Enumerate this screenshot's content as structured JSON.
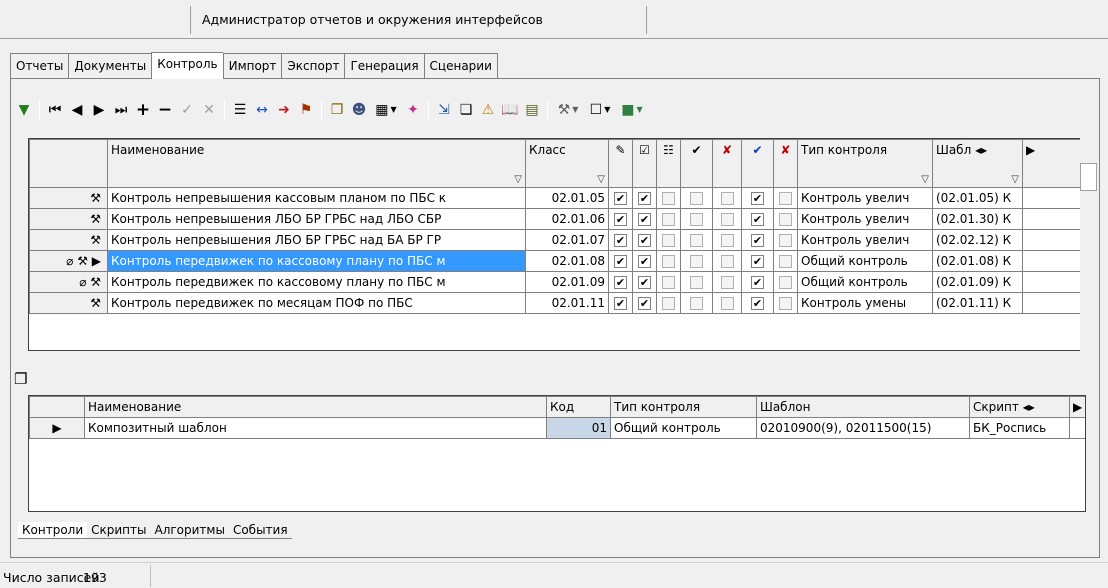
{
  "window": {
    "title": "Администратор отчетов и окружения интерфейсов"
  },
  "main_tabs": [
    {
      "label": "Отчеты",
      "active": false
    },
    {
      "label": "Документы",
      "active": false
    },
    {
      "label": "Контроль",
      "active": true
    },
    {
      "label": "Импорт",
      "active": false
    },
    {
      "label": "Экспорт",
      "active": false
    },
    {
      "label": "Генерация",
      "active": false
    },
    {
      "label": "Сценарии",
      "active": false
    }
  ],
  "toolbar": {
    "icons": [
      "filter-icon",
      "first-record-icon",
      "prev-record-icon",
      "next-record-icon",
      "last-record-icon",
      "add-record-icon",
      "delete-record-icon",
      "edit-record-icon",
      "cancel-record-icon",
      "list-icon",
      "link-icon",
      "export-icon",
      "flag-icon",
      "copy-icon",
      "users-icon",
      "table-icon",
      "puzzle-icon",
      "import-icon",
      "duplicate-icon",
      "warning-icon",
      "book-icon",
      "checklist-icon",
      "hammer-icon",
      "properties-icon",
      "cube-icon"
    ]
  },
  "grid1": {
    "columns": [
      "Наименование",
      "Класс",
      "Тип контроля",
      "Шабл"
    ],
    "rows": [
      {
        "name": "Контроль непревышения кассовым планом по ПБС к",
        "class": "02.01.05",
        "checks": [
          true,
          true,
          false,
          false,
          false,
          true,
          false
        ],
        "type": "Контроль увелич",
        "template": "(02.01.05) К"
      },
      {
        "name": "Контроль непревышения ЛБО БР ГРБС над ЛБО СБР",
        "class": "02.01.06",
        "checks": [
          true,
          true,
          false,
          false,
          false,
          true,
          false
        ],
        "type": "Контроль увелич",
        "template": "(02.01.30) К"
      },
      {
        "name": "Контроль непревышения ЛБО БР ГРБС над БА БР ГР",
        "class": "02.01.07",
        "checks": [
          true,
          true,
          false,
          false,
          false,
          true,
          false
        ],
        "type": "Контроль увелич",
        "template": "(02.02.12) К"
      },
      {
        "name": "Контроль передвижек по кассовому плану по ПБС м",
        "class": "02.01.08",
        "checks": [
          true,
          true,
          false,
          false,
          false,
          true,
          false
        ],
        "type": "Общий контроль",
        "template": "(02.01.08) К",
        "selected": true
      },
      {
        "name": "Контроль передвижек по кассовому плану по ПБС м",
        "class": "02.01.09",
        "checks": [
          true,
          true,
          false,
          false,
          false,
          true,
          false
        ],
        "type": "Общий контроль",
        "template": "(02.01.09) К"
      },
      {
        "name": "Контроль передвижек по месяцам ПОФ по ПБС",
        "class": "02.01.11",
        "checks": [
          true,
          true,
          false,
          false,
          false,
          true,
          false
        ],
        "type": "Контроль умены",
        "template": "(02.01.11) К"
      }
    ]
  },
  "grid2": {
    "columns": [
      "Наименование",
      "Код",
      "Тип контроля",
      "Шаблон",
      "Скрипт"
    ],
    "rows": [
      {
        "name": "Композитный шаблон",
        "code": "01",
        "type": "Общий контроль",
        "template": "02010900(9), 02011500(15)",
        "script": "БК_Роспись"
      }
    ]
  },
  "bottom_tabs": [
    {
      "label": "Контроли",
      "active": true
    },
    {
      "label": "Скрипты",
      "active": false
    },
    {
      "label": "Алгоритмы",
      "active": false
    },
    {
      "label": "События",
      "active": false
    }
  ],
  "status": {
    "label": "Число записей",
    "value": "193"
  }
}
